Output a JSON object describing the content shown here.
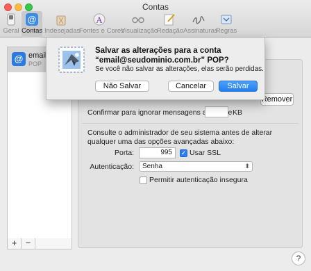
{
  "window": {
    "title": "Contas"
  },
  "toolbar": {
    "items": [
      {
        "label": "Geral",
        "icon": "switch-icon"
      },
      {
        "label": "Contas",
        "icon": "at-sign-icon"
      },
      {
        "label": "Indesejadas",
        "icon": "trash-icon"
      },
      {
        "label": "Fontes e Cores",
        "icon": "fonts-icon"
      },
      {
        "label": "Visualização",
        "icon": "glasses-icon"
      },
      {
        "label": "Redação",
        "icon": "compose-icon"
      },
      {
        "label": "Assinaturas",
        "icon": "signature-icon"
      },
      {
        "label": "Regras",
        "icon": "rules-icon"
      }
    ]
  },
  "accounts": {
    "name": "email@",
    "type": "POP",
    "add_label": "+",
    "remove_label": "−"
  },
  "pane": {
    "remove_button": "Remover",
    "confirm_label": "Confirmar para ignorar mensagens acima de",
    "size_value": "",
    "size_unit": "KB",
    "advanced_note": "Consulte o administrador de seu sistema antes de alterar qualquer uma das opções avançadas abaixo:",
    "port_label": "Porta:",
    "port_value": "995",
    "ssl_label": "Usar SSL",
    "ssl_checked": "✓",
    "auth_label": "Autenticação:",
    "auth_value": "Senha",
    "insecure_label": "Permitir autenticação insegura"
  },
  "dialog": {
    "title": "Salvar as alterações para a conta “email@seudominio.com.br” POP?",
    "message": "Se você não salvar as alterações, elas serão perdidas.",
    "dont_save": "Não Salvar",
    "cancel": "Cancelar",
    "save": "Salvar"
  },
  "help": {
    "label": "?"
  },
  "colors": {
    "accent": "#2b7ff0",
    "close": "#fc605c",
    "minimize": "#fdbc40",
    "maximize": "#34c84a"
  }
}
